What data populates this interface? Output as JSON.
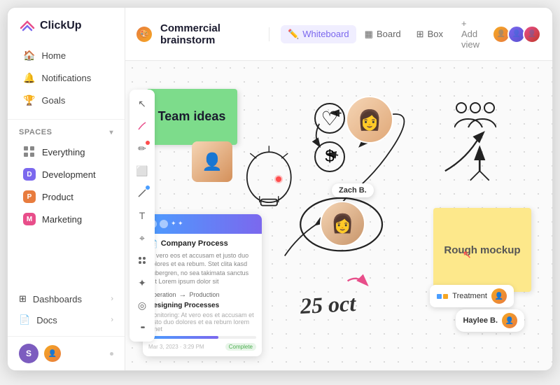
{
  "app": {
    "logo_text": "ClickUp"
  },
  "sidebar": {
    "nav_items": [
      {
        "id": "home",
        "label": "Home",
        "icon": "🏠"
      },
      {
        "id": "notifications",
        "label": "Notifications",
        "icon": "🔔"
      },
      {
        "id": "goals",
        "label": "Goals",
        "icon": "🏆"
      }
    ],
    "spaces_label": "Spaces",
    "spaces": [
      {
        "id": "everything",
        "label": "Everything",
        "type": "everything"
      },
      {
        "id": "development",
        "label": "Development",
        "type": "dev",
        "letter": "D"
      },
      {
        "id": "product",
        "label": "Product",
        "type": "product",
        "letter": "P"
      },
      {
        "id": "marketing",
        "label": "Marketing",
        "type": "marketing",
        "letter": "M"
      }
    ],
    "bottom_items": [
      {
        "id": "dashboards",
        "label": "Dashboards"
      },
      {
        "id": "docs",
        "label": "Docs"
      }
    ],
    "footer_user": "S"
  },
  "topbar": {
    "title_icon": "🎨",
    "title": "Commercial brainstorm",
    "tabs": [
      {
        "id": "whiteboard",
        "label": "Whiteboard",
        "icon": "✏️",
        "active": true
      },
      {
        "id": "board",
        "label": "Board",
        "icon": "▦"
      },
      {
        "id": "box",
        "label": "Box",
        "icon": "⊞"
      }
    ],
    "add_view_label": "+ Add view"
  },
  "canvas": {
    "sticky_green_text": "Team ideas",
    "sticky_yellow_text": "Rough mockup",
    "company_card": {
      "title": "Company Process",
      "description": "At vero eos et accusam et justo duo dolores et ea rebum. Stet clita kasd gubergren, no sea takimata sanctus est Lorem ipsum dolor sit",
      "row_left": "Operation",
      "row_right": "Production",
      "subtitle": "Designing Processes",
      "foot_text": "Monitoring: At vero eos et accusam et justo duo dolores et ea rebum lorem amet",
      "date": "Mar 3, 2023 · 3:29 PM",
      "badge": "Complete",
      "progress": 65
    },
    "oct_label": "25 oct",
    "zach_badge": "Zach B.",
    "haylee_badge": "Haylee B.",
    "treatment_badge": "Treatment"
  },
  "toolbar": {
    "buttons": [
      {
        "id": "cursor",
        "icon": "↖"
      },
      {
        "id": "hand",
        "icon": "☆"
      },
      {
        "id": "pen",
        "icon": "✏"
      },
      {
        "id": "shapes",
        "icon": "⬜"
      },
      {
        "id": "line",
        "icon": "╱"
      },
      {
        "id": "text",
        "icon": "T"
      },
      {
        "id": "image",
        "icon": "⌖"
      },
      {
        "id": "widgets",
        "icon": "⊛"
      },
      {
        "id": "ai",
        "icon": "✦"
      },
      {
        "id": "globe",
        "icon": "◎"
      },
      {
        "id": "more",
        "icon": "•••"
      }
    ]
  }
}
